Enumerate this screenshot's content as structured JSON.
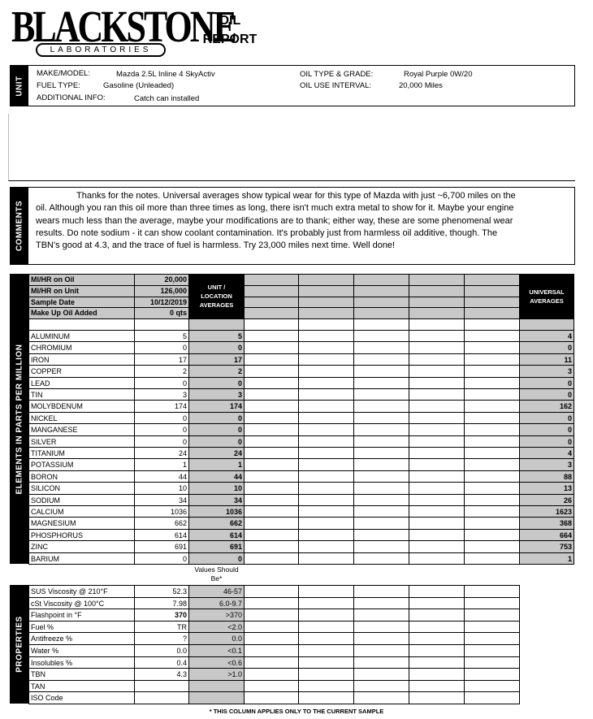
{
  "header": {
    "logo_text": "BLACKSTONE",
    "logo_sub": "LABORATORIES",
    "title_line1": "OIL",
    "title_line2": "REPORT"
  },
  "unit": {
    "section_label": "UNIT",
    "make_model_label": "MAKE/MODEL:",
    "make_model": "Mazda 2.5L Inline 4 SkyActiv",
    "fuel_type_label": "FUEL TYPE:",
    "fuel_type": "Gasoline (Unleaded)",
    "additional_info_label": "ADDITIONAL INFO:",
    "additional_info": "Catch can installed",
    "oil_type_label": "OIL TYPE & GRADE:",
    "oil_type": "Royal Purple 0W/20",
    "oil_interval_label": "OIL USE INTERVAL:",
    "oil_interval": "20,000 Miles"
  },
  "comments": {
    "section_label": "COMMENTS",
    "text": "Thanks for the notes. Universal averages show typical wear for this type of Mazda with just ~6,700 miles on the oil. Although you ran this oil more than three times as long, there isn't much extra metal to show for it. Maybe your engine wears much less than the average, maybe your modifications are to thank; either way, these are some phenomenal wear results. Do note sodium - it can show coolant contamination. It's probably just from harmless oil additive, though. The TBN's good at 4.3, and the trace of fuel is harmless. Try 23,000 miles next time. Well done!"
  },
  "sample": {
    "rows": [
      {
        "label": "MI/HR on Oil",
        "value": "20,000"
      },
      {
        "label": "MI/HR on Unit",
        "value": "126,000"
      },
      {
        "label": "Sample Date",
        "value": "10/12/2019"
      },
      {
        "label": "Make Up Oil Added",
        "value": "0 qts"
      }
    ],
    "unit_avg_header": "UNIT / LOCATION AVERAGES",
    "universal_header": "UNIVERSAL AVERAGES"
  },
  "elements": {
    "section_label": "ELEMENTS IN PARTS PER MILLION",
    "rows": [
      {
        "name": "ALUMINUM",
        "value": "5",
        "unit_avg": "5",
        "universal": "4"
      },
      {
        "name": "CHROMIUM",
        "value": "0",
        "unit_avg": "0",
        "universal": "0"
      },
      {
        "name": "IRON",
        "value": "17",
        "unit_avg": "17",
        "universal": "11"
      },
      {
        "name": "COPPER",
        "value": "2",
        "unit_avg": "2",
        "universal": "3"
      },
      {
        "name": "LEAD",
        "value": "0",
        "unit_avg": "0",
        "universal": "0"
      },
      {
        "name": "TIN",
        "value": "3",
        "unit_avg": "3",
        "universal": "0"
      },
      {
        "name": "MOLYBDENUM",
        "value": "174",
        "unit_avg": "174",
        "universal": "162"
      },
      {
        "name": "NICKEL",
        "value": "0",
        "unit_avg": "0",
        "universal": "0"
      },
      {
        "name": "MANGANESE",
        "value": "0",
        "unit_avg": "0",
        "universal": "0"
      },
      {
        "name": "SILVER",
        "value": "0",
        "unit_avg": "0",
        "universal": "0"
      },
      {
        "name": "TITANIUM",
        "value": "24",
        "unit_avg": "24",
        "universal": "4"
      },
      {
        "name": "POTASSIUM",
        "value": "1",
        "unit_avg": "1",
        "universal": "3"
      },
      {
        "name": "BORON",
        "value": "44",
        "unit_avg": "44",
        "universal": "88"
      },
      {
        "name": "SILICON",
        "value": "10",
        "unit_avg": "10",
        "universal": "13"
      },
      {
        "name": "SODIUM",
        "value": "34",
        "unit_avg": "34",
        "universal": "26"
      },
      {
        "name": "CALCIUM",
        "value": "1036",
        "unit_avg": "1036",
        "universal": "1623"
      },
      {
        "name": "MAGNESIUM",
        "value": "662",
        "unit_avg": "662",
        "universal": "368"
      },
      {
        "name": "PHOSPHORUS",
        "value": "614",
        "unit_avg": "614",
        "universal": "664"
      },
      {
        "name": "ZINC",
        "value": "691",
        "unit_avg": "691",
        "universal": "753"
      },
      {
        "name": "BARIUM",
        "value": "0",
        "unit_avg": "0",
        "universal": "1"
      }
    ]
  },
  "properties": {
    "section_label": "PROPERTIES",
    "should_be_header": "Values Should Be*",
    "rows": [
      {
        "name": "SUS Viscosity @ 210°F",
        "value": "52.3",
        "should_be": "46-57"
      },
      {
        "name": "cSt Viscosity @ 100°C",
        "value": "7.98",
        "should_be": "6.0-9.7"
      },
      {
        "name": "Flashpoint in °F",
        "value": "370",
        "should_be": ">370"
      },
      {
        "name": "Fuel %",
        "value": "TR",
        "should_be": "<2.0"
      },
      {
        "name": "Antifreeze %",
        "value": "?",
        "should_be": "0.0"
      },
      {
        "name": "Water %",
        "value": "0.0",
        "should_be": "<0.1"
      },
      {
        "name": "Insolubles %",
        "value": "0.4",
        "should_be": "<0.6"
      },
      {
        "name": "TBN",
        "value": "4.3",
        "should_be": ">1.0"
      },
      {
        "name": "TAN",
        "value": "",
        "should_be": ""
      },
      {
        "name": "ISO Code",
        "value": "",
        "should_be": ""
      }
    ]
  },
  "footnote": "* THIS COLUMN APPLIES ONLY TO THE CURRENT SAMPLE"
}
